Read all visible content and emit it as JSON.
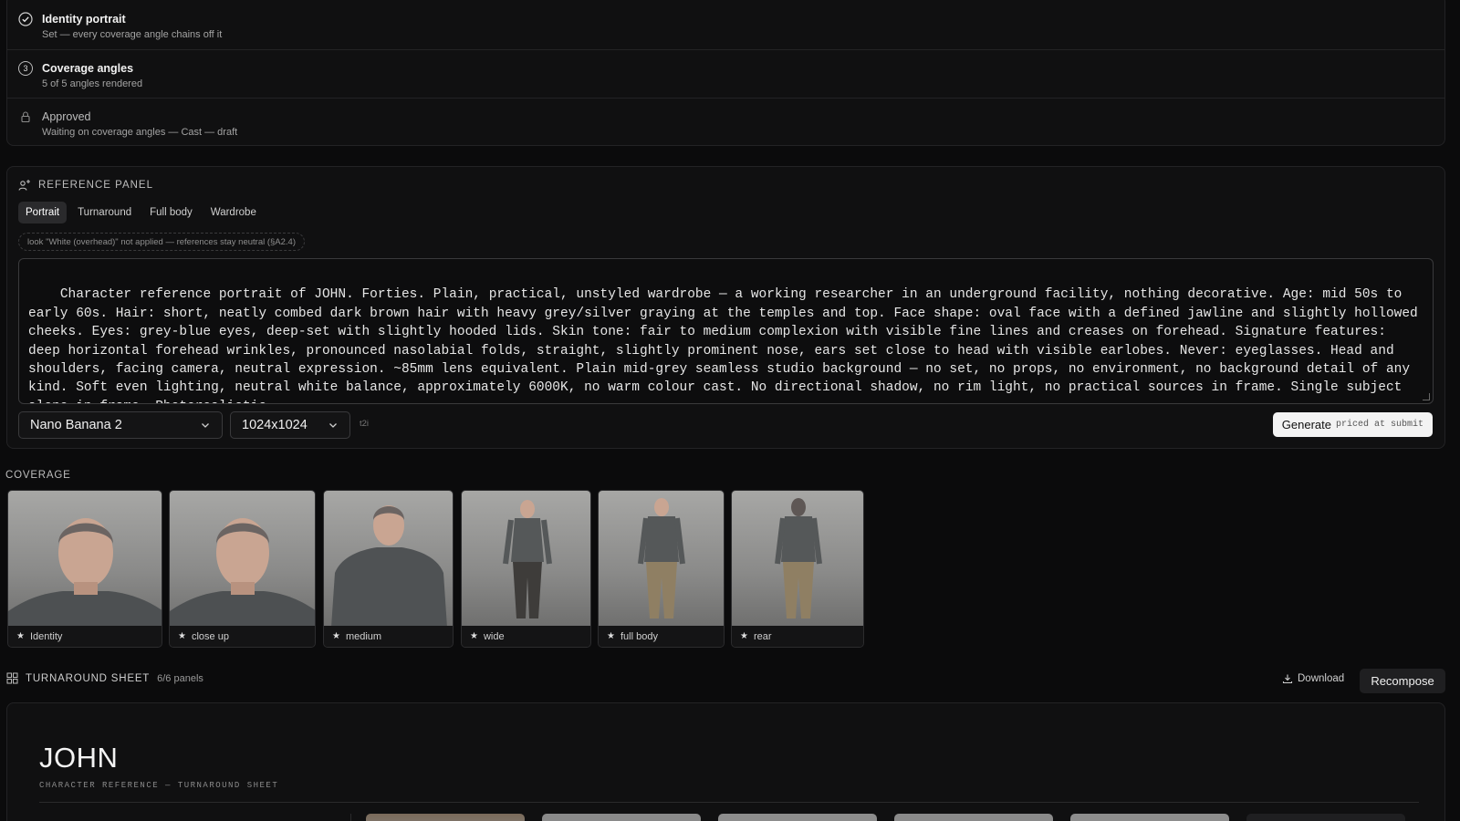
{
  "steps": [
    {
      "title": "Identity portrait",
      "subtitle": "Set — every coverage angle chains off it",
      "state": "done"
    },
    {
      "title": "Coverage angles",
      "subtitle": "5 of 5 angles rendered",
      "number": "3"
    },
    {
      "title": "Approved",
      "subtitle": "Waiting on coverage angles — Cast — draft",
      "state": "locked"
    }
  ],
  "reference_panel": {
    "heading": "REFERENCE PANEL",
    "tabs": [
      "Portrait",
      "Turnaround",
      "Full body",
      "Wardrobe"
    ],
    "active_tab": "Portrait",
    "notice": "look \"White (overhead)\" not applied — references stay neutral (§A2.4)",
    "prompt": "Character reference portrait of JOHN. Forties. Plain, practical, unstyled wardrobe — a working researcher in an underground facility, nothing decorative. Age: mid 50s to early 60s. Hair: short, neatly combed dark brown hair with heavy grey/silver graying at the temples and top. Face shape: oval face with a defined jawline and slightly hollowed cheeks. Eyes: grey-blue eyes, deep-set with slightly hooded lids. Skin tone: fair to medium complexion with visible fine lines and creases on forehead. Signature features: deep horizontal forehead wrinkles, pronounced nasolabial folds, straight, slightly prominent nose, ears set close to head with visible earlobes. Never: eyeglasses. Head and shoulders, facing camera, neutral expression. ~85mm lens equivalent. Plain mid-grey seamless studio background — no set, no props, no environment, no background detail of any kind. Soft even lighting, neutral white balance, approximately 6000K, no warm colour cast. No directional shadow, no rim light, no practical sources in frame. Single subject alone in frame. Photorealistic.",
    "model": "Nano Banana 2",
    "size": "1024x1024",
    "mode": "t2i",
    "generate_label": "Generate",
    "generate_note": "priced at submit"
  },
  "coverage": {
    "heading": "COVERAGE",
    "items": [
      {
        "label": "Identity"
      },
      {
        "label": "close up"
      },
      {
        "label": "medium"
      },
      {
        "label": "wide"
      },
      {
        "label": "full body"
      },
      {
        "label": "rear"
      }
    ]
  },
  "turnaround": {
    "heading": "TURNAROUND SHEET",
    "count": "6/6 panels",
    "download_label": "Download",
    "recompose_label": "Recompose",
    "name": "JOHN",
    "subtitle": "CHARACTER REFERENCE — TURNAROUND SHEET"
  }
}
